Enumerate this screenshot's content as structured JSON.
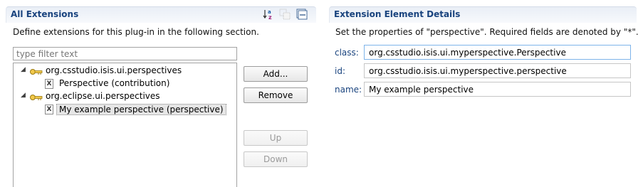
{
  "left_section": {
    "title": "All Extensions",
    "description": "Define extensions for this plug-in in the following section.",
    "filter_placeholder": "type filter text",
    "toolbar_icons": [
      "sort-alphabetical-icon",
      "collapse-disabled-icon",
      "collapse-all-icon"
    ],
    "tree": [
      {
        "label": "org.csstudio.isis.ui.perspectives",
        "icon": "plugin-icon"
      },
      {
        "label": "Perspective (contribution)",
        "icon": "xml-element-icon"
      },
      {
        "label": "org.eclipse.ui.perspectives",
        "icon": "plugin-icon"
      },
      {
        "label": "My example perspective (perspective)",
        "icon": "xml-element-icon",
        "selected": true
      }
    ],
    "buttons": {
      "add": "Add...",
      "remove": "Remove",
      "up": "Up",
      "down": "Down"
    }
  },
  "right_section": {
    "title": "Extension Element Details",
    "description": "Set the properties of \"perspective\". Required fields are denoted by \"*\".",
    "fields": [
      {
        "label": "class:",
        "value": "org.csstudio.isis.ui.myperspective.Perspective"
      },
      {
        "label": "id:",
        "value": "org.csstudio.isis.ui.myperspective.perspective"
      },
      {
        "label": "name:",
        "value": "My example perspective"
      }
    ]
  },
  "colors": {
    "section_title": "#19437e",
    "field_label": "#19437e",
    "selection_bg": "#e6e6e6"
  }
}
